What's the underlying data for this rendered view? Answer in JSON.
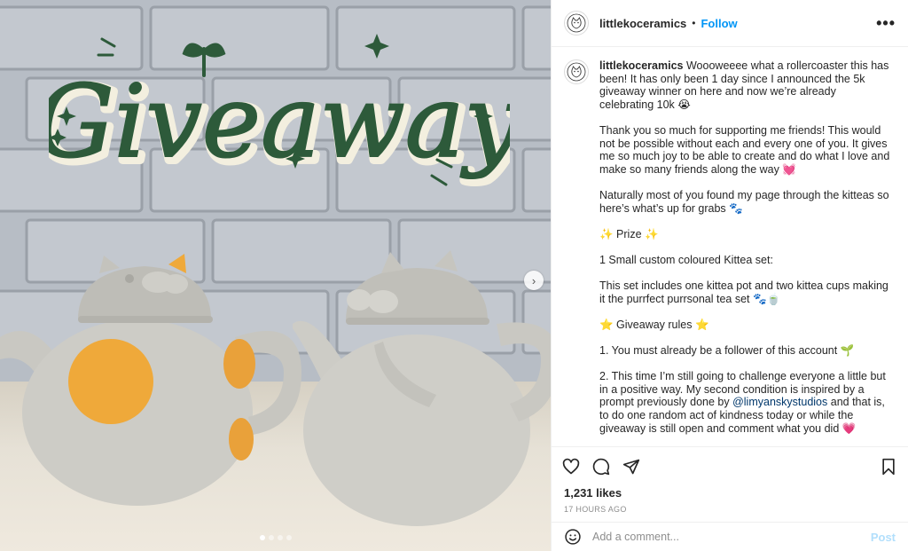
{
  "post": {
    "title_art": "Giveaway",
    "carousel_next_icon": "chevron-right-icon",
    "pager_dots": 4
  },
  "header": {
    "username": "littlekoceramics",
    "separator": "•",
    "follow_label": "Follow",
    "more_icon": "more-options-icon",
    "more_label": "•••"
  },
  "caption": {
    "username": "littlekoceramics",
    "p1": "Woooweeee what a rollercoaster this has been! It has only been 1 day since I announced the 5k giveaway winner on here and now we’re already celebrating 10k 😭",
    "p2": "Thank you so much for supporting me friends! This would not be possible without each and every one of you. It gives me so much joy to be able to create and do what I love and make so many friends along the way 💓",
    "p3": "Naturally most of you found my page through the kitteas so here’s what’s up for grabs 🐾",
    "p4": "✨ Prize ✨",
    "p5": "1 Small custom coloured Kittea set:",
    "p6": "This set includes one kittea pot and two kittea cups making it the purrfect purrsonal tea set 🐾🍵",
    "p7": "⭐ Giveaway rules ⭐",
    "p8": "1. You must already be a follower of this account 🌱",
    "p9_a": "2. This time I’m still going to challenge everyone a little but in a positive way. My second condition is inspired by a prompt previously done by ",
    "p9_mention": "@limyanskystudios",
    "p9_b": " and that is, to do one random act of kindness today or while the giveaway is still open and comment what you did 💗"
  },
  "actions": {
    "like_icon": "heart-icon",
    "comment_icon": "comment-icon",
    "share_icon": "share-icon",
    "save_icon": "bookmark-icon"
  },
  "likes": "1,231 likes",
  "timestamp": "17 HOURS AGO",
  "comment": {
    "emoji_icon": "emoji-icon",
    "placeholder": "Add a comment...",
    "post_label": "Post"
  },
  "colors": {
    "link_blue": "#0095f6",
    "post_disabled": "#b2dffc",
    "title_green": "#2d5a3a"
  }
}
